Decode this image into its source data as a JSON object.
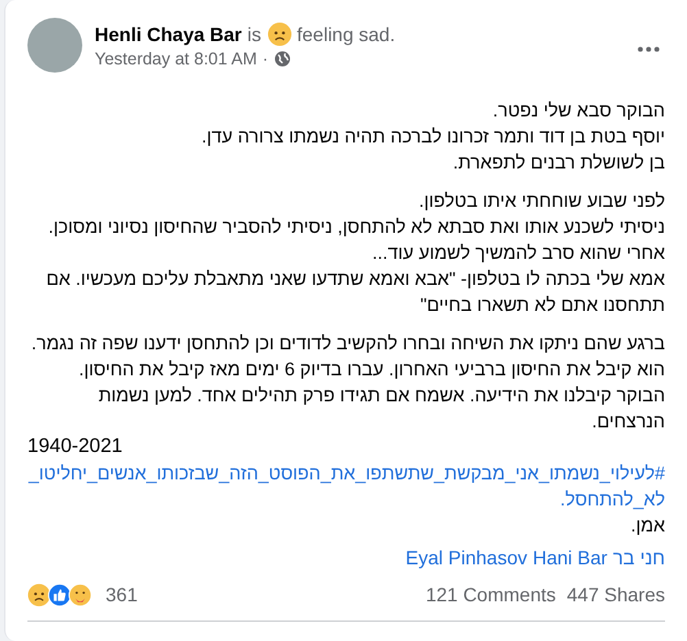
{
  "post": {
    "author": "Henli Chaya Bar",
    "feeling_verb": "is",
    "feeling": "feeling sad.",
    "time": "Yesterday at 8:01 AM",
    "separator": "·"
  },
  "paragraphs": [
    {
      "lines": [
        {
          "kind": "text",
          "text": "הבוקר סבא שלי נפטר."
        },
        {
          "kind": "text",
          "text": "יוסף בטת בן דוד ותמר זכרונו לברכה תהיה נשמתו צרורה עדן."
        },
        {
          "kind": "text",
          "text": "בן לשושלת רבנים לתפארת."
        }
      ]
    },
    {
      "lines": [
        {
          "kind": "text",
          "text": "לפני שבוע שוחחתי איתו בטלפון."
        },
        {
          "kind": "text",
          "text": "ניסיתי לשכנע אותו ואת סבתא לא להתחסן, ניסיתי להסביר שהחיסון נסיוני ומסוכן."
        },
        {
          "kind": "text",
          "text": "אחרי שהוא סרב להמשיך לשמוע עוד..."
        },
        {
          "kind": "text",
          "text": "אמא שלי בכתה לו בטלפון- \"אבא ואמא שתדעו שאני מתאבלת עליכם מעכשיו. אם תתחסנו אתם לא תשארו בחיים\""
        }
      ]
    },
    {
      "lines": [
        {
          "kind": "text",
          "text": "ברגע שהם ניתקו את השיחה ובחרו להקשיב לדודים וכן להתחסן ידענו שפה זה נגמר."
        },
        {
          "kind": "text",
          "text": "הוא קיבל את החיסון ברביעי האחרון. עברו בדיוק 6 ימים מאז קיבל את החיסון."
        },
        {
          "kind": "text",
          "text": "הבוקר קיבלנו את הידיעה. אשמח אם תגידו פרק תהילים אחד. למען נשמות הנרצחים."
        },
        {
          "kind": "number",
          "text": "1940-2021"
        },
        {
          "kind": "hashtag",
          "text": "#לעילוי_נשמתו_אני_מבקשת_שתשתפו_את_הפוסט_הזה_שבזכותו_אנשים_יחליטו_לא_להתחסל."
        },
        {
          "kind": "text",
          "text": "אמן."
        }
      ]
    }
  ],
  "tags": [
    "חני בר",
    "Hani Bar",
    "Eyal Pinhasov"
  ],
  "footer": {
    "reactions_count": "361",
    "comments": "121 Comments",
    "shares": "447 Shares"
  }
}
